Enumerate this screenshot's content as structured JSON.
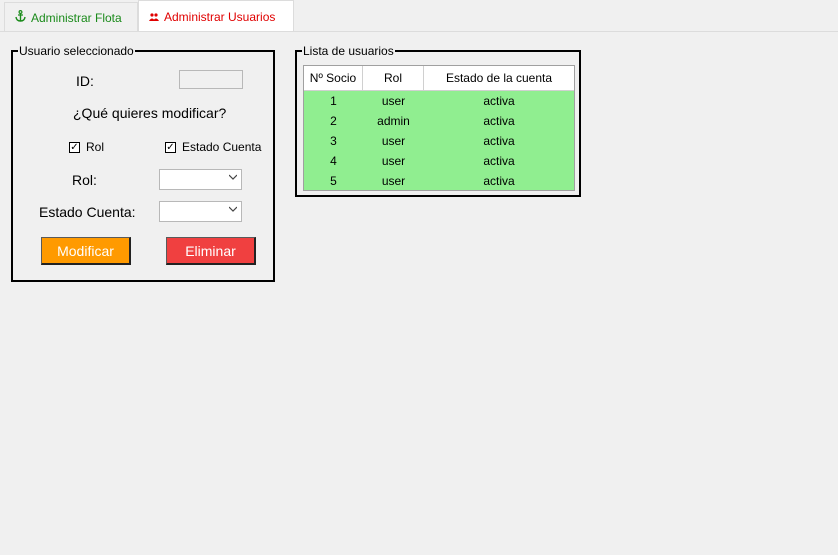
{
  "tabs": [
    {
      "label": "Administrar Flota",
      "icon": "anchor-icon",
      "color": "#1a8a1a"
    },
    {
      "label": "Administrar Usuarios",
      "icon": "users-icon",
      "color": "#e00000"
    }
  ],
  "user_panel": {
    "title": "Usuario seleccionado",
    "id_label": "ID:",
    "id_value": "",
    "question": "¿Qué quieres modificar?",
    "check_rol": {
      "label": "Rol",
      "checked": true
    },
    "check_estado": {
      "label": "Estado Cuenta",
      "checked": true
    },
    "rol_label": "Rol:",
    "rol_value": "",
    "estado_label": "Estado Cuenta:",
    "estado_value": "",
    "modify_button": "Modificar",
    "delete_button": "Eliminar",
    "modify_color": "#ff9a00",
    "delete_color": "#f04040"
  },
  "users_list": {
    "title": "Lista de usuarios",
    "columns": [
      "Nº Socio",
      "Rol",
      "Estado de la cuenta"
    ],
    "rows": [
      [
        "1",
        "user",
        "activa"
      ],
      [
        "2",
        "admin",
        "activa"
      ],
      [
        "3",
        "user",
        "activa"
      ],
      [
        "4",
        "user",
        "activa"
      ],
      [
        "5",
        "user",
        "activa"
      ]
    ],
    "row_color": "#90ee90"
  }
}
